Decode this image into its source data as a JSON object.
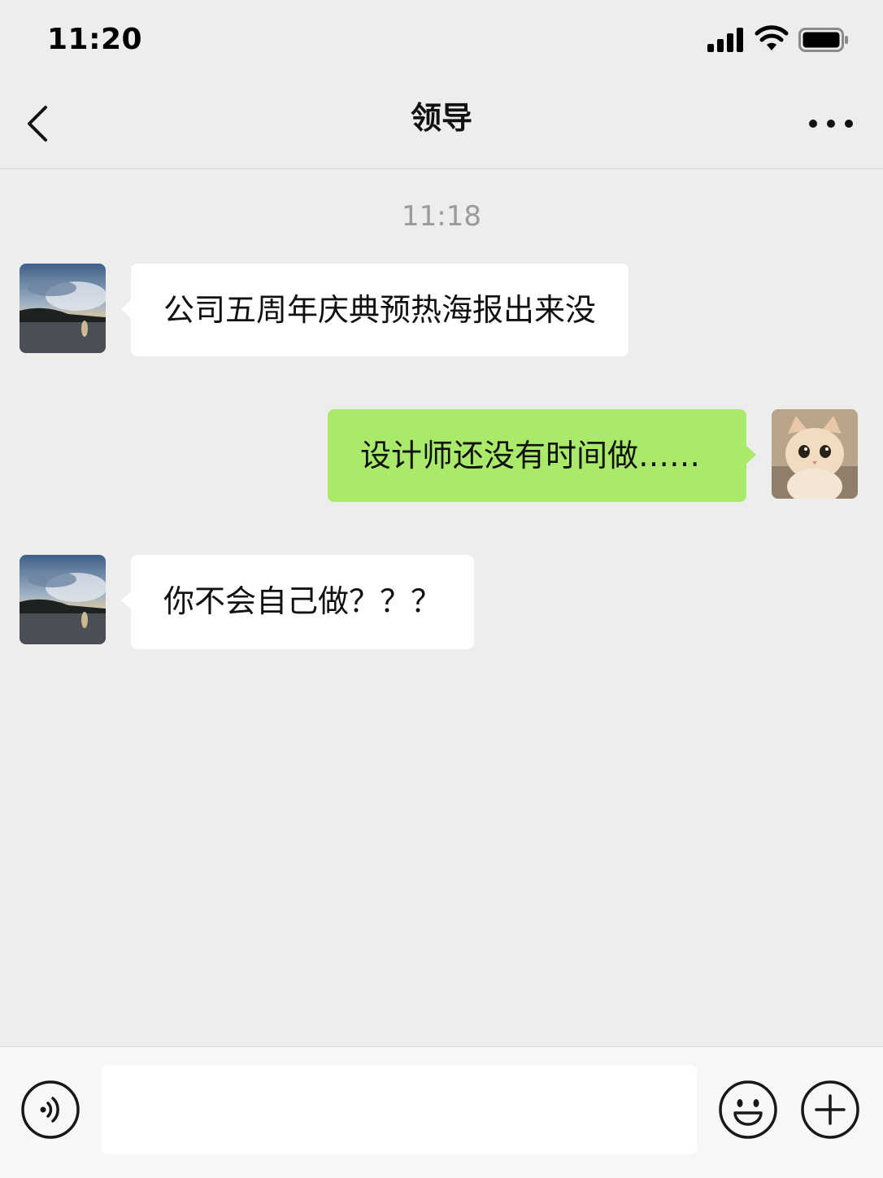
{
  "status_bar": {
    "time": "11:20",
    "icons": [
      "signal-icon",
      "wifi-icon",
      "battery-icon"
    ]
  },
  "nav": {
    "title": "领导",
    "back_icon": "chevron-left-icon",
    "more_icon": "more-dots-icon"
  },
  "chat": {
    "timestamp": "11:18",
    "messages": [
      {
        "sender": "other",
        "text": "公司五周年庆典预热海报出来没",
        "avatar": "landscape-avatar"
      },
      {
        "sender": "me",
        "text": "设计师还没有时间做……",
        "avatar": "cat-avatar"
      },
      {
        "sender": "other",
        "text": "你不会自己做？？？",
        "avatar": "landscape-avatar"
      }
    ]
  },
  "input_bar": {
    "value": "",
    "voice_icon": "voice-icon",
    "emoji_icon": "emoji-icon",
    "plus_icon": "plus-icon"
  },
  "colors": {
    "background": "#ededed",
    "outgoing_bubble": "#a9ea6b",
    "incoming_bubble": "#ffffff",
    "timestamp": "#9a9a9a"
  }
}
